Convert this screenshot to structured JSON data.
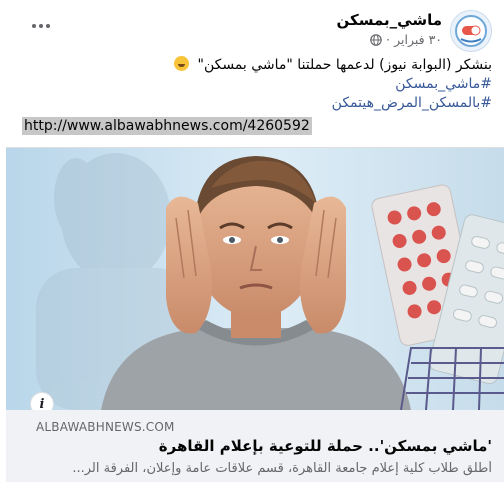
{
  "post": {
    "page_name": "ماشي_بمسكن",
    "date": "٣٠ فبراير",
    "separator": "·",
    "avatar_icon": "page-logo-icon",
    "privacy_icon": "globe-icon",
    "more_icon": "more-options-icon"
  },
  "caption": {
    "text": "بنشكر (البوابة نيوز) لدعمها حملتنا \"ماشي بمسكن\"",
    "emoji_icon": "grinning-face-icon",
    "hashtags": [
      "#ماشي_بمسكن",
      "#بالمسكن_المرض_هيتمكن"
    ],
    "link": "http://www.albawabhnews.com/4260592"
  },
  "card": {
    "domain": "ALBAWABHNEWS.COM",
    "title": "'ماشي بمسكن'.. حملة للتوعية بإعلام القاهرة",
    "description": "أطلق طلاب كلية إعلام جامعة القاهرة، قسم علاقات عامة وإعلان، الفرقة الر...",
    "info_icon": "info-icon"
  },
  "colors": {
    "hashtag": "#385898",
    "meta": "#65676b",
    "footer_bg": "#f0f2f5"
  }
}
